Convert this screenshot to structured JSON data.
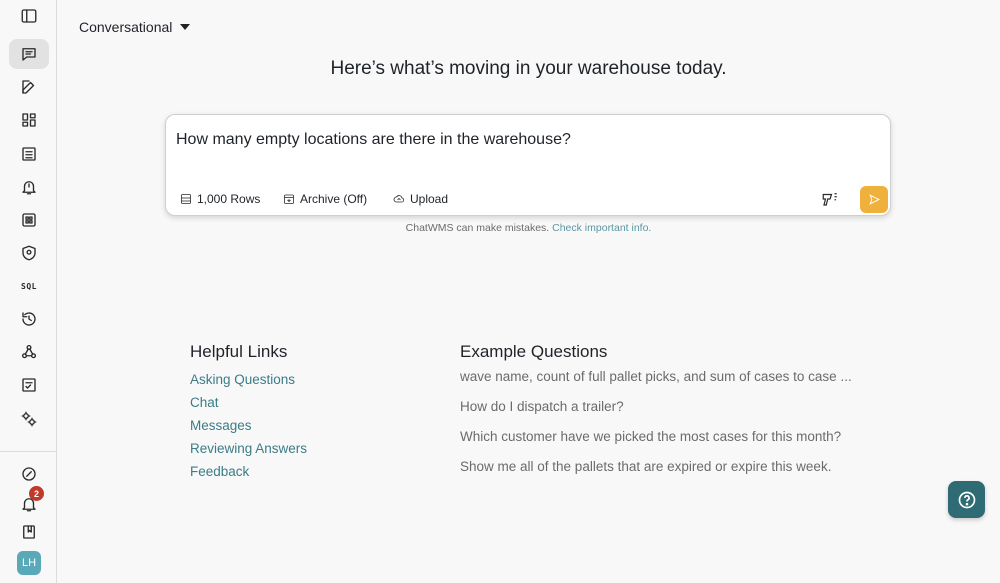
{
  "mode_selector": {
    "label": "Conversational"
  },
  "headline": "Here’s what’s moving in your warehouse today.",
  "chat": {
    "input_value": "How many empty locations are there in the warehouse?",
    "rows_chip": "1,000 Rows",
    "archive_chip": "Archive (Off)",
    "upload_chip": "Upload"
  },
  "disclaimer": {
    "text": "ChatWMS can make mistakes.",
    "link": "Check important info."
  },
  "helpful_links": {
    "title": "Helpful Links",
    "items": [
      "Asking Questions",
      "Chat",
      "Messages",
      "Reviewing Answers",
      "Feedback"
    ]
  },
  "example_questions": {
    "title": "Example Questions",
    "items": [
      "wave name, count of full pallet picks, and sum of cases to case ...",
      "How do I dispatch a trailer?",
      "Which customer have we picked the most cases for this month?",
      "Show me all of the pallets that are expired or expire this week."
    ]
  },
  "sidebar": {
    "sql_label": "SQL",
    "notification_count": "2",
    "avatar_initials": "LH"
  },
  "colors": {
    "accent": "#3b7c87",
    "send": "#f0b03c",
    "help": "#2e6b74",
    "badge": "#c0392b"
  }
}
